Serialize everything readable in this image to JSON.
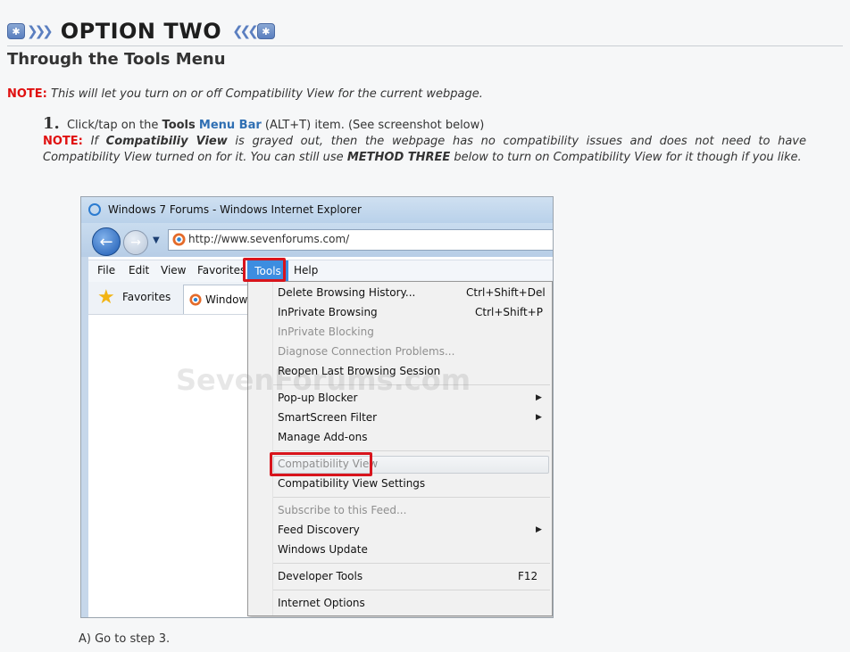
{
  "heading": {
    "title": "OPTION TWO"
  },
  "subtitle": "Through the Tools Menu",
  "note1": {
    "label": "NOTE:",
    "text": "This will let you turn on or off Compatibility View for the current webpage."
  },
  "step1": {
    "number": "1.",
    "pre": "Click/tap on the",
    "tools": "Tools",
    "menubar": "Menu Bar",
    "post": "(ALT+T) item. (See screenshot below)",
    "note_label": "NOTE:",
    "note_a": "If",
    "note_b": "Compatibiliy View",
    "note_c": "is grayed out, then the webpage has no compatibility issues and does not need to have Compatibility View turned on for it. You can still use",
    "note_d": "METHOD THREE",
    "note_e": "below to turn on Compatibility View for it though if you like."
  },
  "screenshot": {
    "window_title": "Windows 7 Forums - Windows Internet Explorer",
    "address": "http://www.sevenforums.com/",
    "menus": [
      "File",
      "Edit",
      "View",
      "Favorites",
      "Tools",
      "Help"
    ],
    "favorites_label": "Favorites",
    "tab_label": "Windows",
    "watermark": "SevenForums.com",
    "tools_menu": [
      {
        "label": "Delete Browsing History...",
        "shortcut": "Ctrl+Shift+Del"
      },
      {
        "label": "InPrivate Browsing",
        "shortcut": "Ctrl+Shift+P"
      },
      {
        "label": "InPrivate Blocking",
        "disabled": true
      },
      {
        "label": "Diagnose Connection Problems...",
        "disabled": true
      },
      {
        "label": "Reopen Last Browsing Session"
      },
      {
        "label": "Pop-up Blocker",
        "submenu": true
      },
      {
        "label": "SmartScreen Filter",
        "submenu": true
      },
      {
        "label": "Manage Add-ons"
      },
      {
        "label": "Compatibility View",
        "disabled": true
      },
      {
        "label": "Compatibility View Settings"
      },
      {
        "label": "Subscribe to this Feed...",
        "disabled": true
      },
      {
        "label": "Feed Discovery",
        "submenu": true
      },
      {
        "label": "Windows Update"
      },
      {
        "label": "Developer Tools",
        "shortcut": "F12"
      },
      {
        "label": "Internet Options"
      }
    ]
  },
  "after_text": "A) Go to step 3."
}
